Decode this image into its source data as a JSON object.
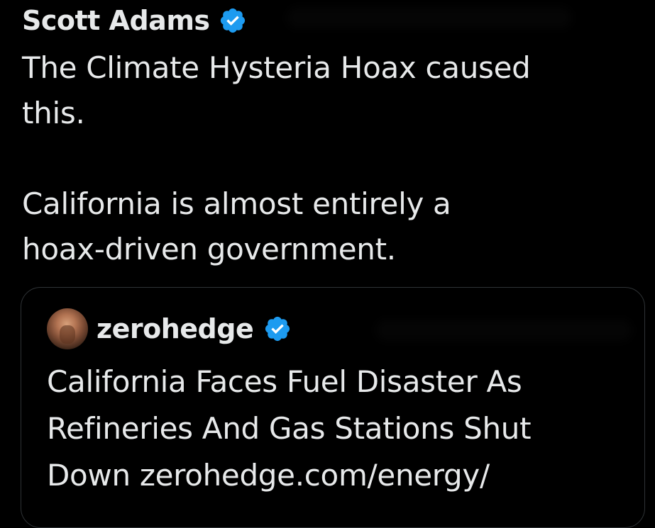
{
  "post": {
    "author": {
      "name": "Scott Adams",
      "verified_badge_icon": "verified-badge-icon",
      "badge_color": "#1d9bf0"
    },
    "text": "The Climate Hysteria Hoax caused\nthis.\n\nCalifornia is almost entirely a\nhoax-driven government."
  },
  "quoted_post": {
    "author": {
      "name": "zerohedge",
      "avatar_icon": "avatar-photo",
      "verified_badge_icon": "verified-badge-icon"
    },
    "text": "California Faces Fuel Disaster As\nRefineries And Gas Stations Shut\nDown zerohedge.com/energy/"
  },
  "theme": {
    "background": "#000000",
    "text_color": "#e7e9ea",
    "border_color": "#2f3336"
  }
}
